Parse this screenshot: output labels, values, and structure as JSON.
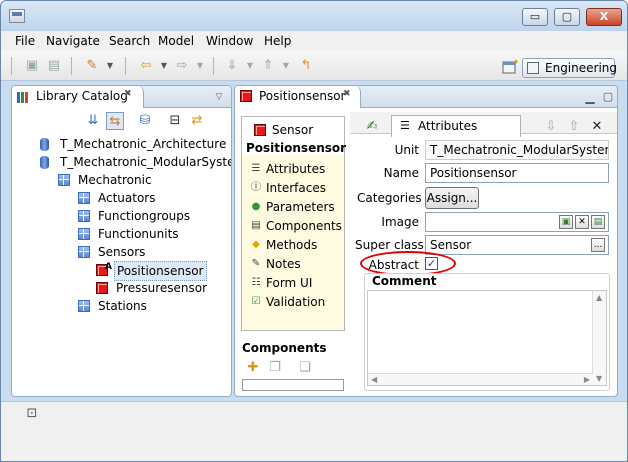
{
  "window": {
    "min_label": "▭",
    "max_label": "▢",
    "close_label": "X"
  },
  "menu": [
    "File",
    "Navigate",
    "Search",
    "Model",
    "Window",
    "Help"
  ],
  "perspective": {
    "label": "Engineering"
  },
  "library": {
    "tab_label": "Library Catalog",
    "tab_close": "✖",
    "tree": [
      {
        "label": "T_Mechatronic_Architecture",
        "icon": "database-icon"
      },
      {
        "label": "T_Mechatronic_ModularSystem",
        "icon": "database-icon"
      },
      {
        "label": "Mechatronic",
        "icon": "package-icon"
      },
      {
        "label": "Actuators",
        "icon": "package-icon"
      },
      {
        "label": "Functiongroups",
        "icon": "package-icon"
      },
      {
        "label": "Functionunits",
        "icon": "package-icon"
      },
      {
        "label": "Sensors",
        "icon": "package-icon"
      },
      {
        "label": "Positionsensor",
        "icon": "abstract-class-icon",
        "selected": true
      },
      {
        "label": "Pressuresensor",
        "icon": "class-icon"
      },
      {
        "label": "Stations",
        "icon": "package-icon"
      }
    ]
  },
  "editor": {
    "tab_label": "Positionsensor",
    "tab_close": "✖",
    "nav": {
      "parent": "Sensor",
      "title": "Positionsensor",
      "items": [
        "Attributes",
        "Interfaces",
        "Parameters",
        "Components",
        "Methods",
        "Notes",
        "Form UI",
        "Validation"
      ],
      "components_label": "Components"
    },
    "section_tab": "Attributes",
    "form": {
      "unit_label": "Unit",
      "unit_value": "T_Mechatronic_ModularSystem.M",
      "name_label": "Name",
      "name_value": "Positionsensor",
      "categories_label": "Categories",
      "assign_button": "Assign...",
      "image_label": "Image",
      "image_value": "",
      "superclass_label": "Super class",
      "superclass_value": "Sensor",
      "browse_button": "...",
      "abstract_label": "Abstract",
      "abstract_checked": true,
      "check_mark": "✓",
      "comment_label": "Comment",
      "comment_value": ""
    }
  },
  "colors": {
    "highlight_circle": "#e00000",
    "selection": "#dde9f9",
    "nav_bg": "#fffbe0"
  }
}
